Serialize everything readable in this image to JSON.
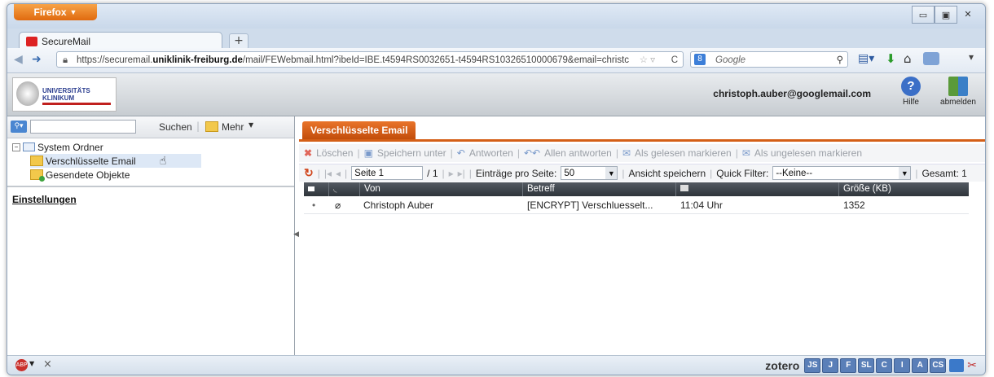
{
  "browser": {
    "menu_button": "Firefox",
    "tab_title": "SecureMail",
    "url_prefix": "https://securemail.",
    "url_domain": "uniklinik-freiburg.de",
    "url_rest": "/mail/FEWebmail.html?ibeId=IBE.t4594RS0032651-t4594RS10326510000679&email=christc",
    "search_placeholder": "Google"
  },
  "header": {
    "logo_text": "UNIVERSITÄTS KLINIKUM",
    "user_email": "christoph.auber@googlemail.com",
    "help_label": "Hilfe",
    "logout_label": "abmelden"
  },
  "sidebar": {
    "search_button": "Suchen",
    "more_button": "Mehr",
    "tree": {
      "root": "System Ordner",
      "items": [
        "Verschlüsselte Email",
        "Gesendete Objekte"
      ]
    },
    "settings_link": "Einstellungen"
  },
  "main": {
    "tab_title": "Verschlüsselte Email",
    "actions": {
      "delete": "Löschen",
      "save_as": "Speichern unter",
      "reply": "Antworten",
      "reply_all": "Allen antworten",
      "mark_read": "Als gelesen markieren",
      "mark_unread": "Als ungelesen markieren"
    },
    "pager": {
      "page_value": "Seite 1",
      "page_total": "/ 1",
      "per_page_label": "Einträge pro Seite:",
      "per_page_value": "50",
      "save_view": "Ansicht speichern",
      "quick_filter_label": "Quick Filter:",
      "quick_filter_value": "--Keine--",
      "total": "Gesamt: 1"
    },
    "columns": [
      "Von",
      "Betreff",
      "Größe (KB)"
    ],
    "rows": [
      {
        "from": "Christoph Auber",
        "subject": "[ENCRYPT] Verschluesselt...",
        "time": "11:04 Uhr",
        "size": "1352"
      }
    ]
  },
  "statusbar": {
    "close": "×",
    "zotero": "zotero",
    "addons": [
      "JS",
      "J",
      "F",
      "SL",
      "C",
      "I",
      "A",
      "CS"
    ]
  },
  "colors": {
    "accent_orange": "#d45f17",
    "header_dark": "#2e343a"
  }
}
